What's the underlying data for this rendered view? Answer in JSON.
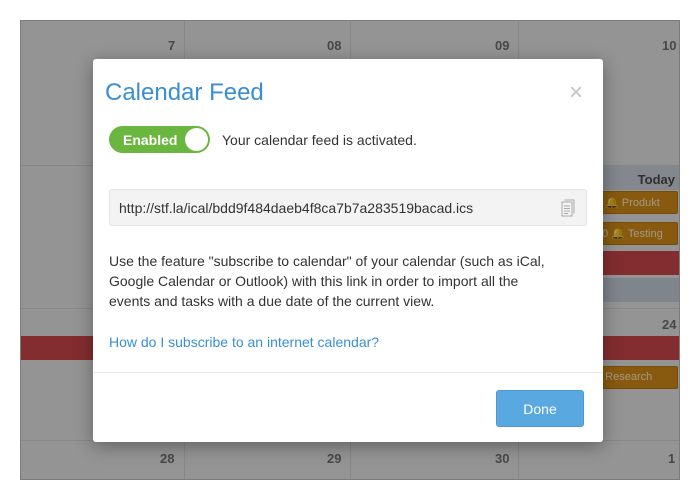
{
  "calendar": {
    "day_numbers": [
      "7",
      "08",
      "09",
      "10",
      "24",
      "28",
      "29",
      "30",
      "1"
    ],
    "today_label": "Today",
    "events": [
      "0 🔔 Produkt",
      "00 🔔 Testing",
      "0 Research"
    ]
  },
  "modal": {
    "title": "Calendar Feed",
    "close_symbol": "×",
    "toggle_label": "Enabled",
    "status_text": "Your calendar feed is activated.",
    "feed_url": "http://stf.la/ical/bdd9f484daeb4f8ca7b7a283519bacad.ics",
    "description": "Use the feature \"subscribe to calendar\" of your calendar (such as iCal, Google Calendar or Outlook) with this link in order to import all the events and tasks with a due date of the current view.",
    "help_link": "How do I subscribe to an internet calendar?",
    "done_label": "Done"
  },
  "colors": {
    "accent": "#3a8fd1",
    "toggle_on": "#6ab63f",
    "event_orange": "#d18a18",
    "event_red": "#c9454a"
  },
  "icons": {
    "close": "close-icon",
    "copy": "copy-icon"
  }
}
